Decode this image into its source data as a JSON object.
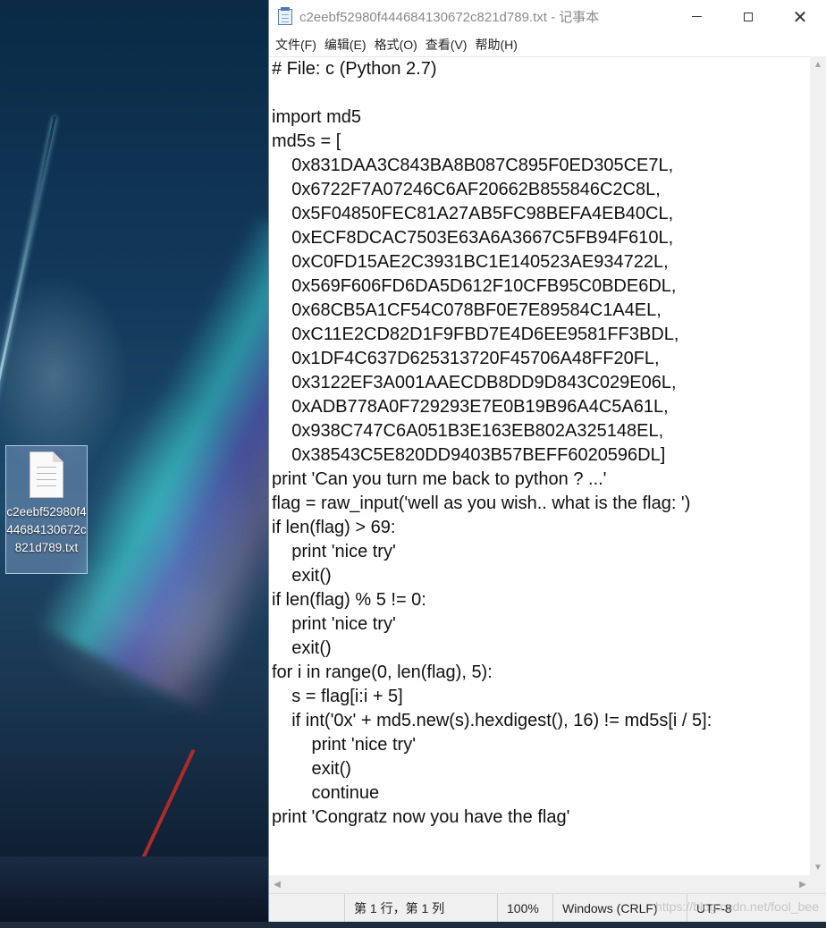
{
  "desktop": {
    "file_icon_label": "c2eebf52980f444684130672c821d789.txt"
  },
  "window": {
    "title": "c2eebf52980f444684130672c821d789.txt - 记事本",
    "controls": {
      "minimize": "minimize",
      "maximize": "maximize",
      "close": "close"
    }
  },
  "menu": {
    "items": [
      "文件(F)",
      "编辑(E)",
      "格式(O)",
      "查看(V)",
      "帮助(H)"
    ]
  },
  "editor": {
    "lines": [
      "# File: c (Python 2.7)",
      "",
      "import md5",
      "md5s = [",
      "    0x831DAA3C843BA8B087C895F0ED305CE7L,",
      "    0x6722F7A07246C6AF20662B855846C2C8L,",
      "    0x5F04850FEC81A27AB5FC98BEFA4EB40CL,",
      "    0xECF8DCAC7503E63A6A3667C5FB94F610L,",
      "    0xC0FD15AE2C3931BC1E140523AE934722L,",
      "    0x569F606FD6DA5D612F10CFB95C0BDE6DL,",
      "    0x68CB5A1CF54C078BF0E7E89584C1A4EL,",
      "    0xC11E2CD82D1F9FBD7E4D6EE9581FF3BDL,",
      "    0x1DF4C637D625313720F45706A48FF20FL,",
      "    0x3122EF3A001AAECDB8DD9D843C029E06L,",
      "    0xADB778A0F729293E7E0B19B96A4C5A61L,",
      "    0x938C747C6A051B3E163EB802A325148EL,",
      "    0x38543C5E820DD9403B57BEFF6020596DL]",
      "print 'Can you turn me back to python ? ...'",
      "flag = raw_input('well as you wish.. what is the flag: ')",
      "if len(flag) > 69:",
      "    print 'nice try'",
      "    exit()",
      "if len(flag) % 5 != 0:",
      "    print 'nice try'",
      "    exit()",
      "for i in range(0, len(flag), 5):",
      "    s = flag[i:i + 5]",
      "    if int('0x' + md5.new(s).hexdigest(), 16) != md5s[i / 5]:",
      "        print 'nice try'",
      "        exit()",
      "        continue",
      "print 'Congratz now you have the flag'"
    ]
  },
  "statusbar": {
    "position": "第 1 行，第 1 列",
    "zoom": "100%",
    "line_ending": "Windows (CRLF)",
    "encoding": "UTF-8"
  },
  "watermark": "https://blog.csdn.net/fool_bee"
}
